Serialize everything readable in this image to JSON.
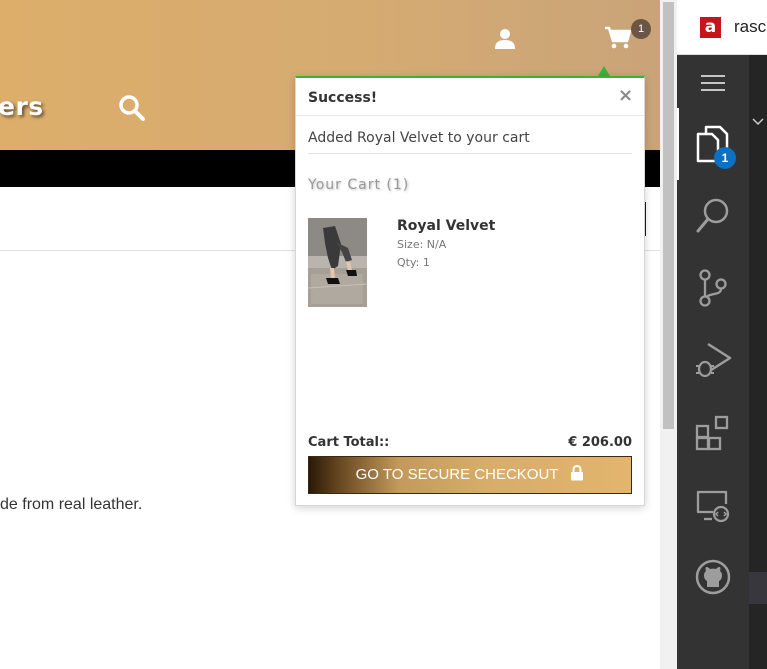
{
  "header": {
    "logo_fragment": "ers",
    "cart_count": "1",
    "icons": {
      "search": "search-icon",
      "user": "user-icon",
      "cart": "cart-icon"
    },
    "gradient_colors": [
      "#dcae6a",
      "#c9a479"
    ]
  },
  "page": {
    "description_fragment": "de from real leather."
  },
  "extension": {
    "logo_letter": "a",
    "text": "rasc"
  },
  "editor": {
    "activity_items": [
      "files-icon",
      "search-icon",
      "source-control-icon",
      "run-debug-icon",
      "extensions-icon",
      "remote-explorer-icon",
      "github-icon"
    ],
    "files_badge": "1",
    "accent": "#0e70c0"
  },
  "mini_cart": {
    "title": "Success!",
    "close_label": "×",
    "message": "Added Royal Velvet to your cart",
    "heading": "Your Cart (1)",
    "item": {
      "name": "Royal Velvet",
      "size": "Size: N/A",
      "qty": "Qty: 1"
    },
    "total_label": "Cart Total::",
    "total_value": "€ 206.00",
    "checkout_label": "GO TO SECURE CHECKOUT",
    "success_color": "#3fae3f"
  }
}
